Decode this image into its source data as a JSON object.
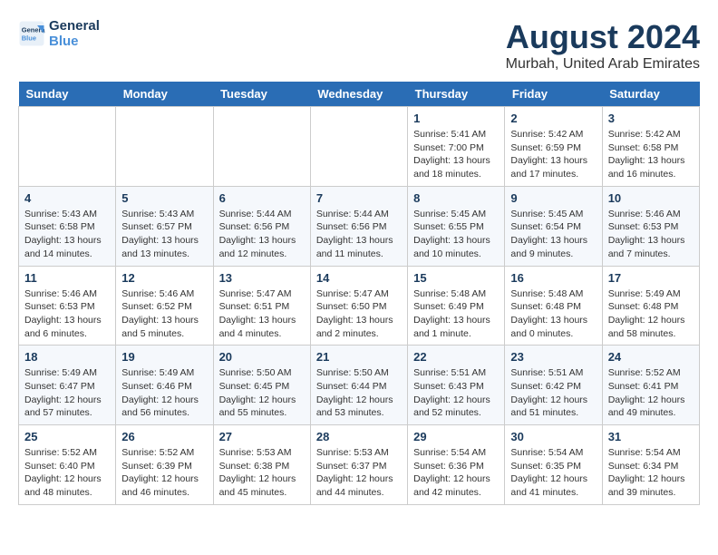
{
  "header": {
    "logo_line1": "General",
    "logo_line2": "Blue",
    "month_year": "August 2024",
    "location": "Murbah, United Arab Emirates"
  },
  "weekdays": [
    "Sunday",
    "Monday",
    "Tuesday",
    "Wednesday",
    "Thursday",
    "Friday",
    "Saturday"
  ],
  "weeks": [
    [
      {
        "date": "",
        "info": ""
      },
      {
        "date": "",
        "info": ""
      },
      {
        "date": "",
        "info": ""
      },
      {
        "date": "",
        "info": ""
      },
      {
        "date": "1",
        "info": "Sunrise: 5:41 AM\nSunset: 7:00 PM\nDaylight: 13 hours\nand 18 minutes."
      },
      {
        "date": "2",
        "info": "Sunrise: 5:42 AM\nSunset: 6:59 PM\nDaylight: 13 hours\nand 17 minutes."
      },
      {
        "date": "3",
        "info": "Sunrise: 5:42 AM\nSunset: 6:58 PM\nDaylight: 13 hours\nand 16 minutes."
      }
    ],
    [
      {
        "date": "4",
        "info": "Sunrise: 5:43 AM\nSunset: 6:58 PM\nDaylight: 13 hours\nand 14 minutes."
      },
      {
        "date": "5",
        "info": "Sunrise: 5:43 AM\nSunset: 6:57 PM\nDaylight: 13 hours\nand 13 minutes."
      },
      {
        "date": "6",
        "info": "Sunrise: 5:44 AM\nSunset: 6:56 PM\nDaylight: 13 hours\nand 12 minutes."
      },
      {
        "date": "7",
        "info": "Sunrise: 5:44 AM\nSunset: 6:56 PM\nDaylight: 13 hours\nand 11 minutes."
      },
      {
        "date": "8",
        "info": "Sunrise: 5:45 AM\nSunset: 6:55 PM\nDaylight: 13 hours\nand 10 minutes."
      },
      {
        "date": "9",
        "info": "Sunrise: 5:45 AM\nSunset: 6:54 PM\nDaylight: 13 hours\nand 9 minutes."
      },
      {
        "date": "10",
        "info": "Sunrise: 5:46 AM\nSunset: 6:53 PM\nDaylight: 13 hours\nand 7 minutes."
      }
    ],
    [
      {
        "date": "11",
        "info": "Sunrise: 5:46 AM\nSunset: 6:53 PM\nDaylight: 13 hours\nand 6 minutes."
      },
      {
        "date": "12",
        "info": "Sunrise: 5:46 AM\nSunset: 6:52 PM\nDaylight: 13 hours\nand 5 minutes."
      },
      {
        "date": "13",
        "info": "Sunrise: 5:47 AM\nSunset: 6:51 PM\nDaylight: 13 hours\nand 4 minutes."
      },
      {
        "date": "14",
        "info": "Sunrise: 5:47 AM\nSunset: 6:50 PM\nDaylight: 13 hours\nand 2 minutes."
      },
      {
        "date": "15",
        "info": "Sunrise: 5:48 AM\nSunset: 6:49 PM\nDaylight: 13 hours\nand 1 minute."
      },
      {
        "date": "16",
        "info": "Sunrise: 5:48 AM\nSunset: 6:48 PM\nDaylight: 13 hours\nand 0 minutes."
      },
      {
        "date": "17",
        "info": "Sunrise: 5:49 AM\nSunset: 6:48 PM\nDaylight: 12 hours\nand 58 minutes."
      }
    ],
    [
      {
        "date": "18",
        "info": "Sunrise: 5:49 AM\nSunset: 6:47 PM\nDaylight: 12 hours\nand 57 minutes."
      },
      {
        "date": "19",
        "info": "Sunrise: 5:49 AM\nSunset: 6:46 PM\nDaylight: 12 hours\nand 56 minutes."
      },
      {
        "date": "20",
        "info": "Sunrise: 5:50 AM\nSunset: 6:45 PM\nDaylight: 12 hours\nand 55 minutes."
      },
      {
        "date": "21",
        "info": "Sunrise: 5:50 AM\nSunset: 6:44 PM\nDaylight: 12 hours\nand 53 minutes."
      },
      {
        "date": "22",
        "info": "Sunrise: 5:51 AM\nSunset: 6:43 PM\nDaylight: 12 hours\nand 52 minutes."
      },
      {
        "date": "23",
        "info": "Sunrise: 5:51 AM\nSunset: 6:42 PM\nDaylight: 12 hours\nand 51 minutes."
      },
      {
        "date": "24",
        "info": "Sunrise: 5:52 AM\nSunset: 6:41 PM\nDaylight: 12 hours\nand 49 minutes."
      }
    ],
    [
      {
        "date": "25",
        "info": "Sunrise: 5:52 AM\nSunset: 6:40 PM\nDaylight: 12 hours\nand 48 minutes."
      },
      {
        "date": "26",
        "info": "Sunrise: 5:52 AM\nSunset: 6:39 PM\nDaylight: 12 hours\nand 46 minutes."
      },
      {
        "date": "27",
        "info": "Sunrise: 5:53 AM\nSunset: 6:38 PM\nDaylight: 12 hours\nand 45 minutes."
      },
      {
        "date": "28",
        "info": "Sunrise: 5:53 AM\nSunset: 6:37 PM\nDaylight: 12 hours\nand 44 minutes."
      },
      {
        "date": "29",
        "info": "Sunrise: 5:54 AM\nSunset: 6:36 PM\nDaylight: 12 hours\nand 42 minutes."
      },
      {
        "date": "30",
        "info": "Sunrise: 5:54 AM\nSunset: 6:35 PM\nDaylight: 12 hours\nand 41 minutes."
      },
      {
        "date": "31",
        "info": "Sunrise: 5:54 AM\nSunset: 6:34 PM\nDaylight: 12 hours\nand 39 minutes."
      }
    ]
  ]
}
